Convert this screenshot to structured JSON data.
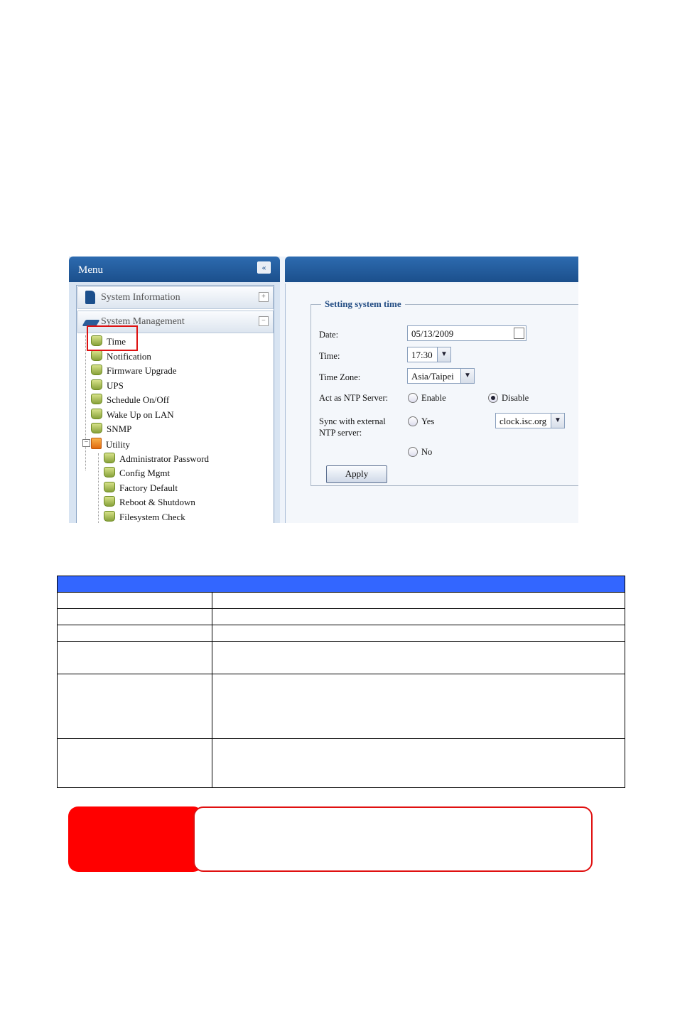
{
  "menu": {
    "title": "Menu",
    "collapse_label": "«",
    "sections": [
      {
        "label": "System Information",
        "toggle": "+"
      },
      {
        "label": "System Management",
        "toggle": "−"
      }
    ],
    "items": [
      "Time",
      "Notification",
      "Firmware Upgrade",
      "UPS",
      "Schedule On/Off",
      "Wake Up on LAN",
      "SNMP"
    ],
    "utility": {
      "label": "Utility",
      "items": [
        "Administrator Password",
        "Config Mgmt",
        "Factory Default",
        "Reboot & Shutdown",
        "Filesystem Check"
      ]
    }
  },
  "form": {
    "legend": "Setting system time",
    "date_label": "Date:",
    "date_value": "05/13/2009",
    "time_label": "Time:",
    "time_value": "17:30",
    "timezone_label": "Time Zone:",
    "timezone_value": "Asia/Taipei",
    "ntp_label": "Act as NTP Server:",
    "ntp_enable": "Enable",
    "ntp_disable": "Disable",
    "sync_label_1": "Sync with external",
    "sync_label_2": "NTP server:",
    "sync_yes": "Yes",
    "sync_no": "No",
    "ntp_server_value": "clock.isc.org",
    "apply_label": "Apply"
  },
  "colors": {
    "table_header": "#3366ff",
    "note_accent": "#ff0000"
  }
}
